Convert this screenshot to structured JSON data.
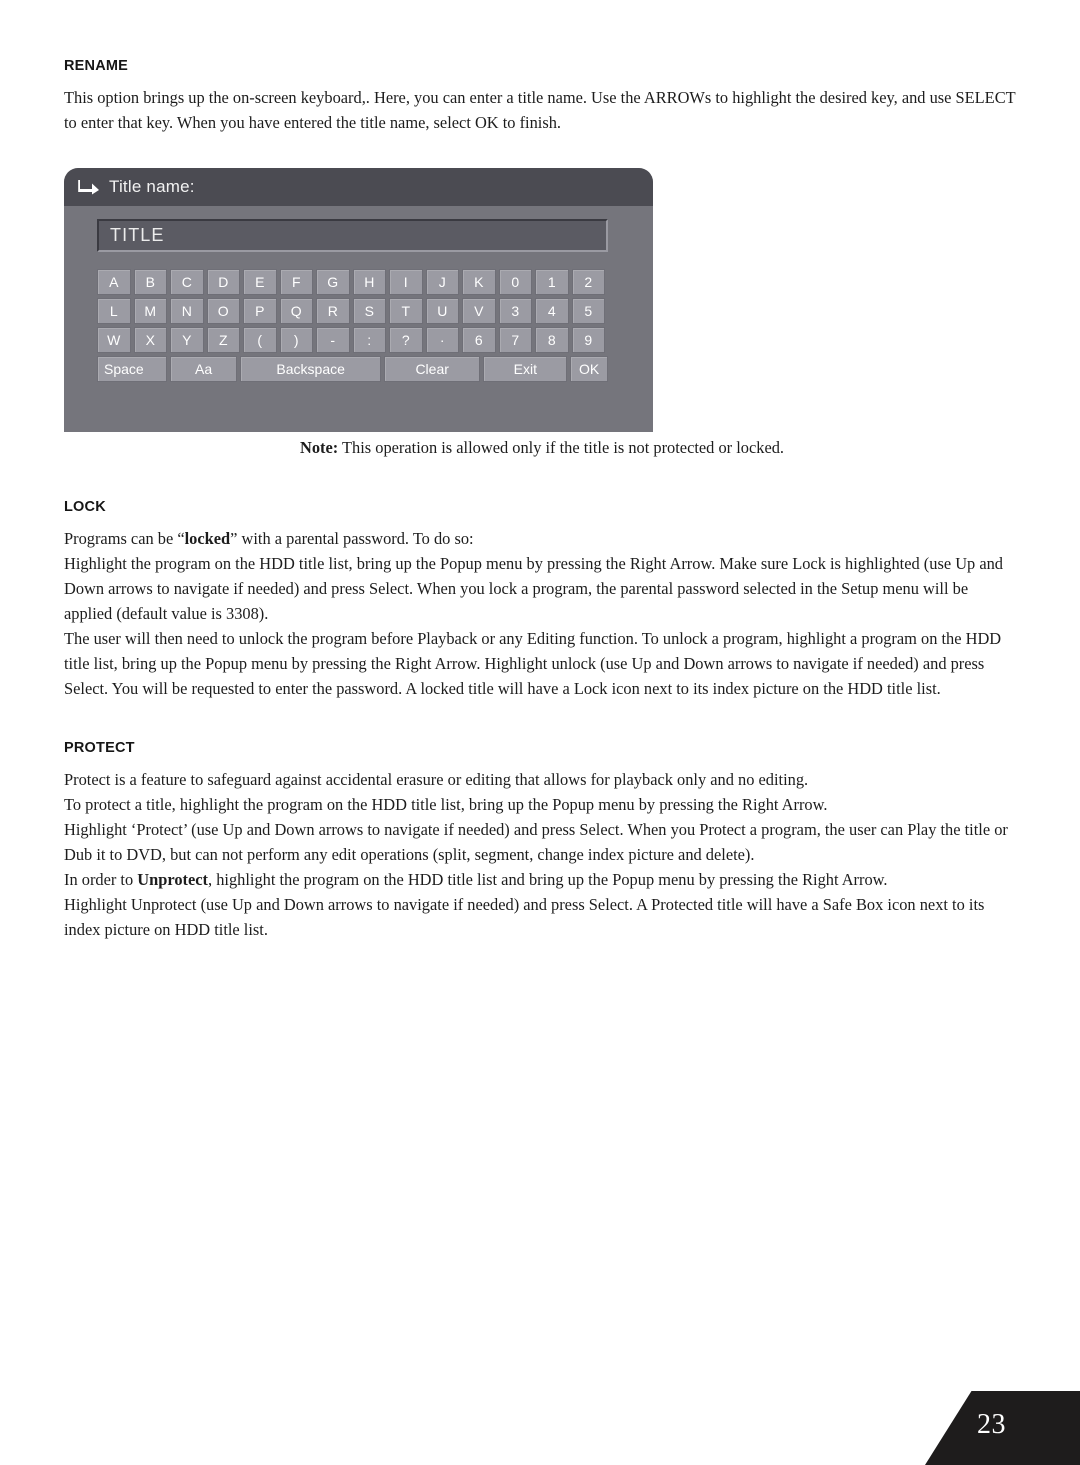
{
  "document": {
    "page_number": "23"
  },
  "sections": {
    "rename": {
      "heading": "RENAME",
      "paragraph": "This option brings up the on-screen keyboard,. Here, you can enter a title name. Use the ARROWs to highlight the desired key, and use SELECT to enter that key. When you have entered the title name, select OK to finish.",
      "note_label": "Note:",
      "note_text": " This operation is allowed only if the title is not protected or locked."
    },
    "lock": {
      "heading": "LOCK",
      "para1_a": "Programs can be “",
      "para1_bold": "locked",
      "para1_b": "” with a parental password. To do so:",
      "para2": "Highlight the program on the HDD title list, bring up the Popup menu by pressing the Right Arrow. Make sure Lock is highlighted (use Up and Down arrows to navigate if needed) and press Select. When you lock a program, the parental password selected in the Setup menu will be applied (default value is 3308).",
      "para3": "The user will then need to unlock the program before Playback or any Editing function. To unlock a program, highlight a program on the HDD title list, bring up the Popup menu by pressing the Right Arrow. Highlight unlock (use Up and Down arrows to navigate if needed) and press Select. You will be requested to enter the password. A locked title will have a Lock icon next to its index picture on the HDD title list."
    },
    "protect": {
      "heading": "PROTECT",
      "para1": "Protect is a feature to safeguard against accidental erasure or editing that allows for playback only and no editing.",
      "para2": "To protect a title, highlight the program on the HDD title list, bring up the Popup menu by pressing the Right Arrow.",
      "para3": "Highlight ‘Protect’ (use Up and Down arrows to navigate if needed) and press Select. When you Protect a program, the user can Play the title or Dub it to DVD, but can not perform any edit operations (split, segment, change index picture and delete).",
      "para4_a": "In order to ",
      "para4_bold": "Unprotect",
      "para4_b": ", highlight the program on the HDD title list and bring up the Popup menu by pressing the Right Arrow.",
      "para5": "Highlight Unprotect (use Up and Down arrows to navigate if needed) and press Select. A Protected title will have a Safe Box icon next to its index picture on HDD title list."
    }
  },
  "osk": {
    "title_icon": "return-arrow-icon",
    "title": "Title name:",
    "field_value": "TITLE",
    "rows": [
      [
        "A",
        "B",
        "C",
        "D",
        "E",
        "F",
        "G",
        "H",
        "I",
        "J",
        "K",
        "0",
        "1",
        "2"
      ],
      [
        "L",
        "M",
        "N",
        "O",
        "P",
        "Q",
        "R",
        "S",
        "T",
        "U",
        "V",
        "3",
        "4",
        "5"
      ],
      [
        "W",
        "X",
        "Y",
        "Z",
        "(",
        ")",
        "-",
        ":",
        "?",
        "·",
        "6",
        "7",
        "8",
        "9"
      ]
    ],
    "function_keys": [
      {
        "label": "Space",
        "key": "space"
      },
      {
        "label": "Aa",
        "key": "aa"
      },
      {
        "label": "Backspace",
        "key": "backspace"
      },
      {
        "label": "Clear",
        "key": "clear"
      },
      {
        "label": "Exit",
        "key": "exit"
      },
      {
        "label": "OK",
        "key": "ok"
      }
    ],
    "colors": {
      "dialog_bg": "#75757c",
      "titlebar_bg": "#4b4b52",
      "field_bg": "#5b5b63",
      "key_bg": "#9b9ba3",
      "key_text": "#ffffff"
    }
  }
}
